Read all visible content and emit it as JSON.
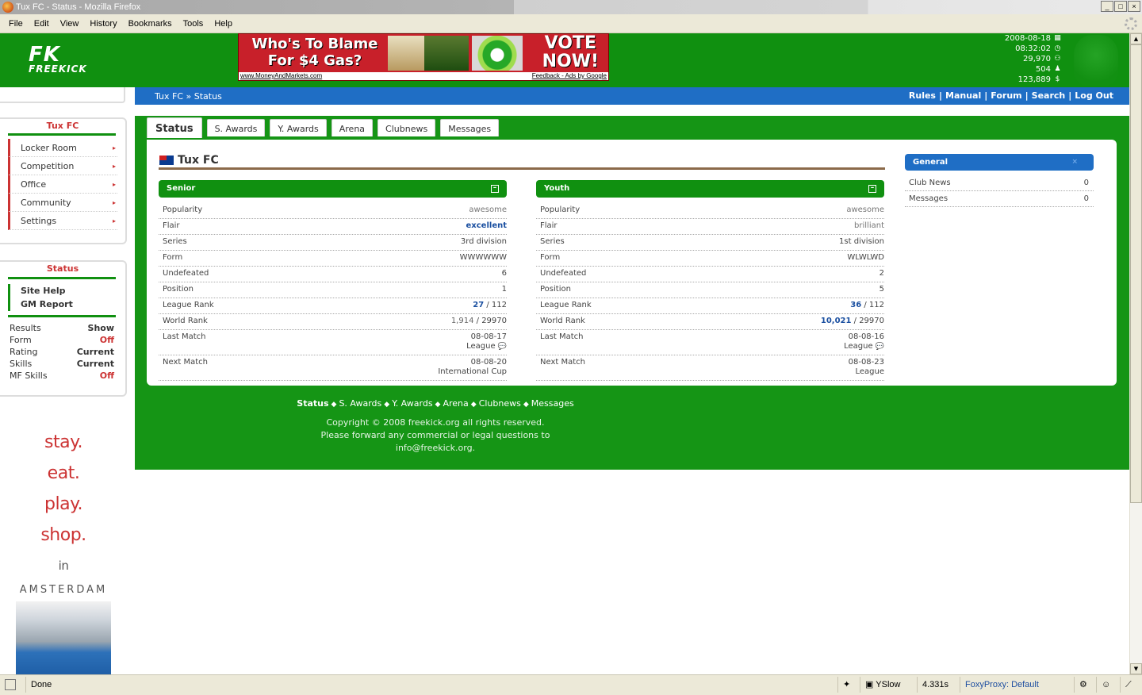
{
  "window": {
    "title": "Tux FC - Status - Mozilla Firefox"
  },
  "menu": [
    "File",
    "Edit",
    "View",
    "History",
    "Bookmarks",
    "Tools",
    "Help"
  ],
  "logo": {
    "main": "FK",
    "sub": "FREEKICK"
  },
  "ad": {
    "headline_line1": "Who's To Blame",
    "headline_line2": "For $4 Gas?",
    "cta_line1": "VOTE",
    "cta_line2": "NOW!",
    "url": "www.MoneyAndMarkets.com",
    "footer": "Feedback - Ads by Google"
  },
  "header_info": {
    "date": "2008-08-18",
    "time": "08:32:02",
    "users": "29,970",
    "online": "504",
    "money": "123,889"
  },
  "breadcrumb": "Tux FC » Status",
  "top_links": [
    "Rules",
    "Manual",
    "Forum",
    "Search",
    "Log Out"
  ],
  "sidebar": {
    "club_title": "Tux FC",
    "nav": [
      "Locker Room",
      "Competition",
      "Office",
      "Community",
      "Settings"
    ],
    "status_title": "Status",
    "help": [
      "Site Help",
      "GM Report"
    ],
    "settings": [
      {
        "label": "Results",
        "value": "Show"
      },
      {
        "label": "Form",
        "value": "Off"
      },
      {
        "label": "Rating",
        "value": "Current"
      },
      {
        "label": "Skills",
        "value": "Current"
      },
      {
        "label": "MF Skills",
        "value": "Off"
      }
    ],
    "slogan": [
      "stay.",
      "eat.",
      "play.",
      "shop."
    ],
    "slogan_in": "in",
    "slogan_city": "AMSTERDAM"
  },
  "tabs": [
    "Status",
    "S. Awards",
    "Y. Awards",
    "Arena",
    "Clubnews",
    "Messages"
  ],
  "club": {
    "name": "Tux FC"
  },
  "senior": {
    "title": "Senior",
    "rows": {
      "popularity": {
        "label": "Popularity",
        "value": "awesome"
      },
      "flair": {
        "label": "Flair",
        "value": "excellent"
      },
      "series": {
        "label": "Series",
        "value": "3rd division"
      },
      "form": {
        "label": "Form",
        "value": "WWWWWW"
      },
      "undefeated": {
        "label": "Undefeated",
        "value": "6"
      },
      "position": {
        "label": "Position",
        "value": "1"
      },
      "league_rank": {
        "label": "League Rank",
        "value": "27",
        "total": "112"
      },
      "world_rank": {
        "label": "World Rank",
        "value": "1,914",
        "total": "29970"
      },
      "last_match": {
        "label": "Last Match",
        "date": "08-08-17",
        "type": "League"
      },
      "next_match": {
        "label": "Next Match",
        "date": "08-08-20",
        "type": "International Cup"
      }
    }
  },
  "youth": {
    "title": "Youth",
    "rows": {
      "popularity": {
        "label": "Popularity",
        "value": "awesome"
      },
      "flair": {
        "label": "Flair",
        "value": "brilliant"
      },
      "series": {
        "label": "Series",
        "value": "1st division"
      },
      "form": {
        "label": "Form",
        "value": "WLWLWD"
      },
      "undefeated": {
        "label": "Undefeated",
        "value": "2"
      },
      "position": {
        "label": "Position",
        "value": "5"
      },
      "league_rank": {
        "label": "League Rank",
        "value": "36",
        "total": "112"
      },
      "world_rank": {
        "label": "World Rank",
        "value": "10,021",
        "total": "29970"
      },
      "last_match": {
        "label": "Last Match",
        "date": "08-08-16",
        "type": "League"
      },
      "next_match": {
        "label": "Next Match",
        "date": "08-08-23",
        "type": "League"
      }
    }
  },
  "general": {
    "title": "General",
    "rows": [
      {
        "label": "Club News",
        "value": "0"
      },
      {
        "label": "Messages",
        "value": "0"
      }
    ]
  },
  "footer": {
    "links": [
      "Status",
      "S. Awards",
      "Y. Awards",
      "Arena",
      "Clubnews",
      "Messages"
    ],
    "copyright1": "Copyright © 2008 freekick.org all rights reserved.",
    "copyright2": "Please forward any commercial or legal questions to",
    "copyright3": "info@freekick.org."
  },
  "statusbar": {
    "text": "Done",
    "yslow": "YSlow",
    "time": "4.331s",
    "proxy": "FoxyProxy: Default"
  },
  "colors": {
    "green": "#109010",
    "blue": "#1f6ec5",
    "red": "#cc3333"
  }
}
